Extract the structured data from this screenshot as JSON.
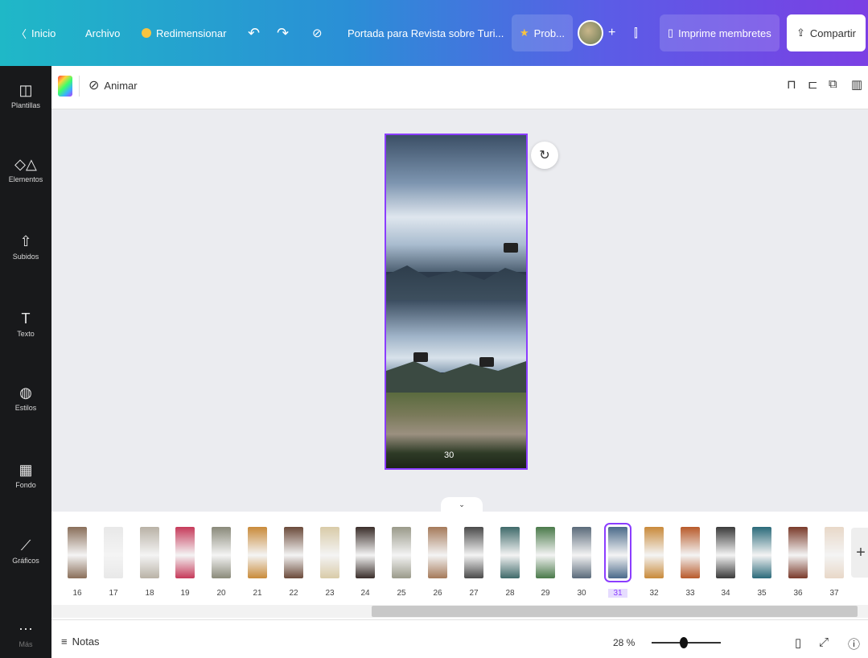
{
  "topbar": {
    "home_label": "Inicio",
    "file_label": "Archivo",
    "resize_label": "Redimensionar",
    "doc_title": "Portada para Revista sobre Turi...",
    "pro_label": "Prob...",
    "print_label": "Imprime membretes",
    "share_label": "Compartir"
  },
  "sidebar": {
    "items": [
      {
        "label": "Plantillas",
        "icon": "template-icon"
      },
      {
        "label": "Elementos",
        "icon": "shapes-icon"
      },
      {
        "label": "Subidos",
        "icon": "upload-icon"
      },
      {
        "label": "Texto",
        "icon": "text-icon"
      },
      {
        "label": "Estilos",
        "icon": "palette-icon"
      },
      {
        "label": "Fondo",
        "icon": "pattern-icon"
      },
      {
        "label": "Gráficos",
        "icon": "chart-icon"
      },
      {
        "label": "Más",
        "icon": "more-icon"
      }
    ]
  },
  "toolbar": {
    "animate_label": "Animar"
  },
  "canvas": {
    "page_number": "30"
  },
  "pages": {
    "labels": [
      "16",
      "17",
      "18",
      "19",
      "20",
      "21",
      "22",
      "23",
      "24",
      "25",
      "26",
      "27",
      "28",
      "29",
      "30",
      "31",
      "32",
      "33",
      "34",
      "35",
      "36",
      "37"
    ],
    "selected": "31",
    "colors": [
      "#8a6f5a",
      "#e8e8e8",
      "#b9b2a6",
      "#c63a5a",
      "#8a8a7a",
      "#c98b3a",
      "#6b4a3a",
      "#d9cba8",
      "#3a2e2a",
      "#9a9a8a",
      "#a57a5a",
      "#4a4a4a",
      "#3f6a6a",
      "#4a7a4a",
      "#5a6a7a",
      "#4a6a8a",
      "#c98a3a",
      "#b85a2a",
      "#3a3a3a",
      "#2a6a7a",
      "#7a3a2a",
      "#e8d8c8"
    ]
  },
  "bottombar": {
    "notes_label": "Notas",
    "zoom_label": "28 %",
    "zoom_value": 0.28
  },
  "colors": {
    "accent": "#8b3dff",
    "gradient_start": "#1fb8c7",
    "gradient_end": "#7b3fe4"
  }
}
